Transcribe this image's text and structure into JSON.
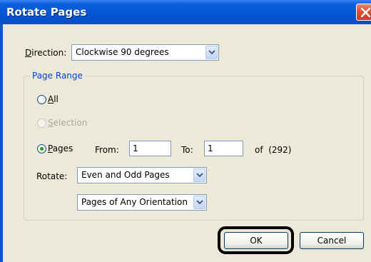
{
  "dialog": {
    "title": "Rotate Pages",
    "close_icon": "close-icon"
  },
  "direction": {
    "label_u": "D",
    "label_rest": "irection:",
    "value": "Clockwise 90 degrees"
  },
  "page_range": {
    "title": "Page Range",
    "all_u": "A",
    "all_rest": "ll",
    "selection_u": "S",
    "selection_rest": "election",
    "pages_u": "P",
    "pages_rest": "ages",
    "from_label": "From:",
    "from_value": "1",
    "to_label": "To:",
    "to_value": "1",
    "of_text": "of  (292)",
    "selected": "pages",
    "rotate_label": "Rotate:",
    "rotate_value": "Even and Odd Pages",
    "orientation_value": "Pages of Any Orientation"
  },
  "buttons": {
    "ok": "OK",
    "cancel": "Cancel"
  }
}
